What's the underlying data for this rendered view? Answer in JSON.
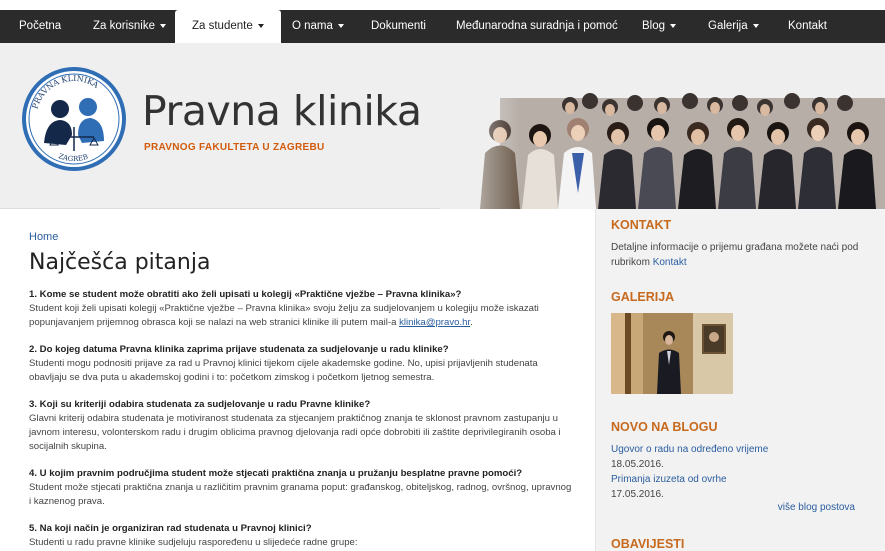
{
  "nav": {
    "items": [
      {
        "label": "Početna",
        "dropdown": false
      },
      {
        "label": "Za korisnike",
        "dropdown": true
      },
      {
        "label": "Za studente",
        "dropdown": true,
        "active": true
      },
      {
        "label": "O nama",
        "dropdown": true
      },
      {
        "label": "Dokumenti",
        "dropdown": false
      },
      {
        "label": "Međunarodna suradnja i pomoć",
        "dropdown": false
      },
      {
        "label": "Blog",
        "dropdown": true
      },
      {
        "label": "Galerija",
        "dropdown": true
      },
      {
        "label": "Kontakt",
        "dropdown": false
      }
    ]
  },
  "header": {
    "title": "Pravna klinika",
    "subtitle": "PRAVNOG FAKULTETA U ZAGREBU",
    "logo_text": "PRAVNA KLINIKA",
    "logo_text_bottom": "ZAGREB"
  },
  "main": {
    "breadcrumb": "Home",
    "title": "Najčešća pitanja",
    "faq": [
      {
        "q": "1. Kome se student  može obratiti ako želi upisati u kolegij «Praktične vježbe – Pravna klinika»?",
        "a": "Student koji želi upisati kolegij «Praktične vježbe – Pravna klinika» svoju želju za sudjelovanjem u kolegiju može iskazati popunjavanjem prijemnog obrasca koji se nalazi na web stranici klinike ili putem mail-a ",
        "a_link": "klinika@pravo.hr",
        "a_end": "."
      },
      {
        "q": "2. Do kojeg datuma Pravna klinika zaprima prijave studenata za sudjelovanje u radu klinike?",
        "a": "Studenti mogu podnositi prijave za rad u Pravnoj klinici tijekom cijele akademske godine. No, upisi prijavljenih studenata obavljaju se dva puta u akademskoj godini i to: početkom zimskog i početkom ljetnog semestra."
      },
      {
        "q": "3. Koji su kriteriji odabira studenata za sudjelovanje u radu Pravne klinike?",
        "a": "Glavni kriterij odabira studenata je motiviranost studenata za stjecanjem praktičnog znanja te sklonost pravnom zastupanju u javnom interesu, volonterskom radu i drugim oblicima pravnog djelovanja radi opće dobrobiti ili zaštite deprivilegiranih osoba i socijalnih skupina."
      },
      {
        "q": "4. U kojim pravnim područjima student može stjecati praktična znanja u pružanju besplatne pravne pomoći?",
        "a": "Student može stjecati praktična znanja u različitim pravnim granama poput: građanskog, obiteljskog, radnog, ovršnog, upravnog i kaznenog prava."
      },
      {
        "q": "5. Na koji način je organiziran rad studenata u Pravnoj klinici?",
        "a": "Studenti u radu pravne klinike sudjeluju raspoređenu u slijedeće radne grupe:"
      }
    ]
  },
  "sidebar": {
    "kontakt": {
      "heading": "KONTAKT",
      "text": "Detaljne informacije o prijemu građana možete naći pod rubrikom ",
      "link": "Kontakt"
    },
    "galerija": {
      "heading": "GALERIJA"
    },
    "blog": {
      "heading": "NOVO NA BLOGU",
      "posts": [
        {
          "title": "Ugovor o radu na određeno vrijeme",
          "date": "18.05.2016."
        },
        {
          "title": "Primanja izuzeta od ovrhe",
          "date": "17.05.2016."
        }
      ],
      "more": "više blog postova"
    },
    "obavijesti": {
      "heading": "OBAVIJESTI"
    }
  },
  "colors": {
    "nav_bg": "#2b2b2b",
    "accent_orange": "#c76a1e",
    "link_blue": "#2a5d9f",
    "logo_blue": "#2f6db5"
  }
}
